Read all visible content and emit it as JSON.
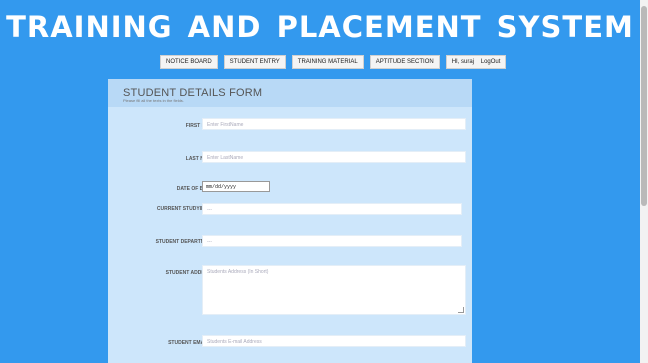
{
  "header": {
    "title": "TRAINING AND PLACEMENT SYSTEM"
  },
  "nav": {
    "items": [
      {
        "label": "NOTICE BOARD"
      },
      {
        "label": "STUDENT ENTRY"
      },
      {
        "label": "TRAINING MATERIAL"
      },
      {
        "label": "APTITUDE SECTION"
      },
      {
        "label": "HI, suraj    LogOut"
      }
    ]
  },
  "form": {
    "title": "STUDENT DETAILS FORM",
    "subtitle": "Please fill all the texts in the fields.",
    "fields": {
      "first_name": {
        "label": "FIRST NAME:",
        "placeholder": "Enter FirstName"
      },
      "last_name": {
        "label": "LAST NAME :",
        "placeholder": "Enter LastName"
      },
      "dob": {
        "label": "DATE OF BIRTH :",
        "value": "mm/dd/yyyy"
      },
      "current_studying": {
        "label": "CURRENT STUDYING IN :",
        "value": "---"
      },
      "department": {
        "label": "STUDENT DEPARTMENT :",
        "value": "---"
      },
      "address": {
        "label": "STUDENT ADDRESS :",
        "placeholder": "Students Address (In Short)"
      },
      "email": {
        "label": "STUDENT EMAIL ID :",
        "placeholder": "Students E-mail Address"
      }
    }
  },
  "colors": {
    "page_background": "#3399ee",
    "form_panel": "#cde6fb",
    "form_header": "#b8d9f6"
  }
}
